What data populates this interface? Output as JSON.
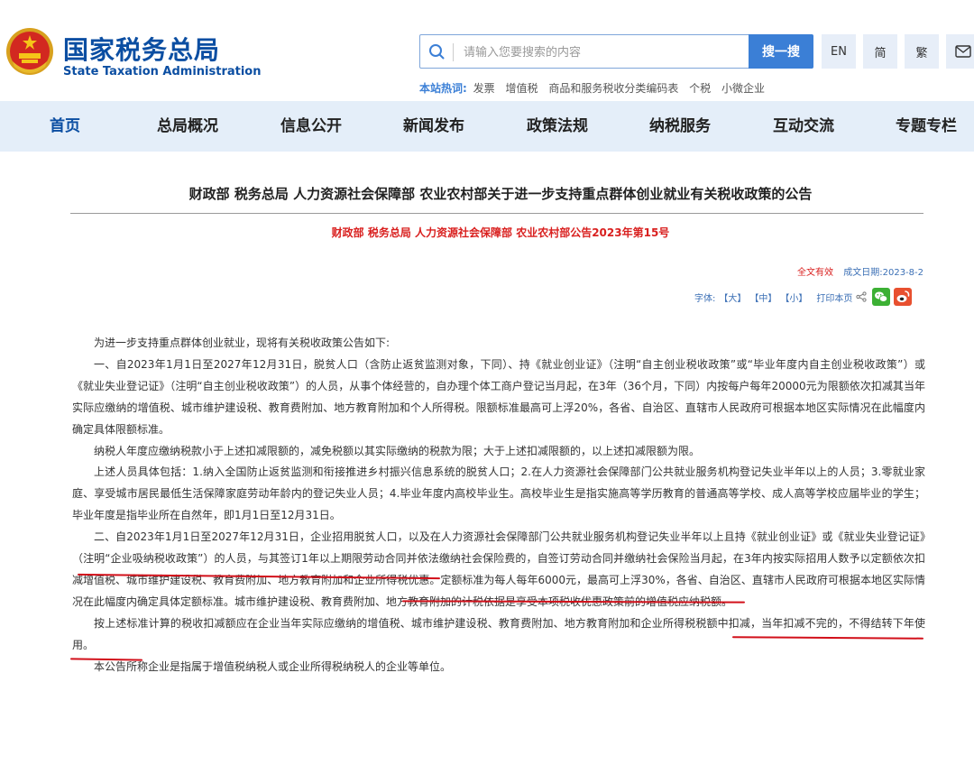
{
  "header": {
    "logo_cn": "国家税务总局",
    "logo_en": "State Taxation Administration",
    "search": {
      "placeholder": "请输入您要搜索的内容",
      "button_label": "搜一搜"
    },
    "tools": {
      "en": "EN",
      "simplified": "简",
      "traditional": "繁"
    },
    "hot": {
      "label": "本站热词:",
      "items": [
        "发票",
        "增值税",
        "商品和服务税收分类编码表",
        "个税",
        "小微企业"
      ]
    }
  },
  "nav": {
    "items": [
      "首页",
      "总局概况",
      "信息公开",
      "新闻发布",
      "政策法规",
      "纳税服务",
      "互动交流",
      "专题专栏"
    ]
  },
  "article": {
    "title": "财政部 税务总局 人力资源社会保障部 农业农村部关于进一步支持重点群体创业就业有关税收政策的公告",
    "doc_no": "财政部 税务总局 人力资源社会保障部 农业农村部公告2023年第15号",
    "validity": "全文有效",
    "date": "成文日期:2023-8-2",
    "font_label": "字体:",
    "font_large": "【大】",
    "font_medium": "【中】",
    "font_small": "【小】",
    "print_label": "打印本页",
    "intro": "为进一步支持重点群体创业就业，现将有关税收政策公告如下:",
    "para1": "一、自2023年1月1日至2027年12月31日，脱贫人口（含防止返贫监测对象，下同）、持《就业创业证》（注明“自主创业税收政策”或“毕业年度内自主创业税收政策”）或《就业失业登记证》（注明“自主创业税收政策”）的人员，从事个体经营的，自办理个体工商户登记当月起，在3年（36个月，下同）内按每户每年20000元为限额依次扣减其当年实际应缴纳的增值税、城市维护建设税、教育费附加、地方教育附加和个人所得税。限额标准最高可上浮20%，各省、自治区、直辖市人民政府可根据本地区实际情况在此幅度内确定具体限额标准。",
    "para2": "纳税人年度应缴纳税款小于上述扣减限额的，减免税额以其实际缴纳的税款为限；大于上述扣减限额的，以上述扣减限额为限。",
    "para3": "上述人员具体包括：1.纳入全国防止返贫监测和衔接推进乡村振兴信息系统的脱贫人口；2.在人力资源社会保障部门公共就业服务机构登记失业半年以上的人员；3.零就业家庭、享受城市居民最低生活保障家庭劳动年龄内的登记失业人员；4.毕业年度内高校毕业生。高校毕业生是指实施高等学历教育的普通高等学校、成人高等学校应届毕业的学生；毕业年度是指毕业所在自然年，即1月1日至12月31日。",
    "para4": "二、自2023年1月1日至2027年12月31日，企业招用脱贫人口，以及在人力资源社会保障部门公共就业服务机构登记失业半年以上且持《就业创业证》或《就业失业登记证》（注明“企业吸纳税收政策”）的人员，与其签订1年以上期限劳动合同并依法缴纳社会保险费的，自签订劳动合同并缴纳社会保险当月起，在3年内按实际招用人数予以定额依次扣减增值税、城市维护建设税、教育费附加、地方教育附加和企业所得税优惠。定额标准为每人每年6000元，最高可上浮30%，各省、自治区、直辖市人民政府可根据本地区实际情况在此幅度内确定具体定额标准。城市维护建设税、教育费附加、地方教育附加的计税依据是享受本项税收优惠政策前的增值税应纳税额。",
    "para5": "按上述标准计算的税收扣减额应在企业当年实际应缴纳的增值税、城市维护建设税、教育费附加、地方教育附加和企业所得税税额中扣减，当年扣减不完的，不得结转下年使用。",
    "para6": "本公告所称企业是指属于增值税纳税人或企业所得税纳税人的企业等单位。"
  },
  "colors": {
    "brand_blue": "#0b4ea2",
    "nav_bg": "#e4eef9",
    "search_button": "#3b7fd6",
    "doc_no_red": "#d9201f",
    "annotation_red": "#d2101a"
  }
}
